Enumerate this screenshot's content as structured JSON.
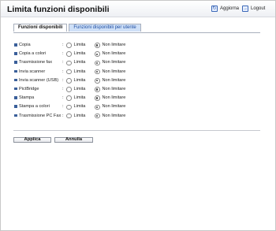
{
  "header": {
    "title": "Limita funzioni disponibili",
    "refresh_label": "Aggiorna",
    "logout_label": "Logout"
  },
  "tabs": [
    {
      "label": "Funzioni disponibili",
      "active": true
    },
    {
      "label": "Funzioni disponibili per utente",
      "active": false
    }
  ],
  "options": {
    "limit_label": "Limita",
    "nolimit_label": "Non limitare",
    "separator": ":"
  },
  "functions": [
    {
      "name": "Copia",
      "selected": "nolimit"
    },
    {
      "name": "Copia a colori",
      "selected": "nolimit"
    },
    {
      "name": "Trasmissione fax",
      "selected": "nolimit"
    },
    {
      "name": "Invia scanner",
      "selected": "nolimit"
    },
    {
      "name": "Invia scanner (USB)",
      "selected": "nolimit"
    },
    {
      "name": "PictBridge",
      "selected": "nolimit"
    },
    {
      "name": "Stampa",
      "selected": "nolimit"
    },
    {
      "name": "Stampa a colori",
      "selected": "nolimit"
    },
    {
      "name": "Trasmissione PC Fax",
      "selected": "nolimit"
    }
  ],
  "actions": {
    "apply_label": "Applica",
    "cancel_label": "Annulla"
  }
}
